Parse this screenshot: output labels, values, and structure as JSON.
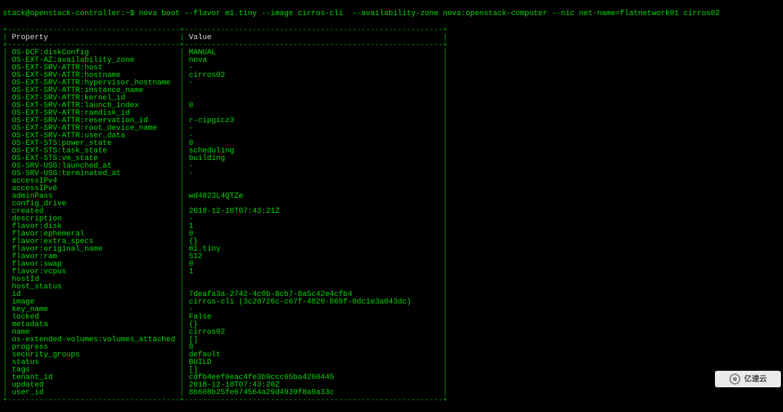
{
  "prompt": "stack@openstack-controller:~$ nova boot --flavor m1.tiny --image cirros-cli  --availability-zone nova:openstack-computer --nic net-name=flatnetwork01 cirros02",
  "header": {
    "col1": "Property",
    "col2": "Value"
  },
  "col1_width": 38,
  "col2_width": 57,
  "rows": [
    {
      "p": "OS-DCF:diskConfig",
      "v": "MANUAL"
    },
    {
      "p": "OS-EXT-AZ:availability_zone",
      "v": "nova"
    },
    {
      "p": "OS-EXT-SRV-ATTR:host",
      "v": "-"
    },
    {
      "p": "OS-EXT-SRV-ATTR:hostname",
      "v": "cirros02"
    },
    {
      "p": "OS-EXT-SRV-ATTR:hypervisor_hostname",
      "v": "-"
    },
    {
      "p": "OS-EXT-SRV-ATTR:instance_name",
      "v": ""
    },
    {
      "p": "OS-EXT-SRV-ATTR:kernel_id",
      "v": ""
    },
    {
      "p": "OS-EXT-SRV-ATTR:launch_index",
      "v": "0"
    },
    {
      "p": "OS-EXT-SRV-ATTR:ramdisk_id",
      "v": ""
    },
    {
      "p": "OS-EXT-SRV-ATTR:reservation_id",
      "v": "r-cipgicz3"
    },
    {
      "p": "OS-EXT-SRV-ATTR:root_device_name",
      "v": "-"
    },
    {
      "p": "OS-EXT-SRV-ATTR:user_data",
      "v": "-"
    },
    {
      "p": "OS-EXT-STS:power_state",
      "v": "0"
    },
    {
      "p": "OS-EXT-STS:task_state",
      "v": "scheduling"
    },
    {
      "p": "OS-EXT-STS:vm_state",
      "v": "building"
    },
    {
      "p": "OS-SRV-USG:launched_at",
      "v": "-"
    },
    {
      "p": "OS-SRV-USG:terminated_at",
      "v": "-"
    },
    {
      "p": "accessIPv4",
      "v": ""
    },
    {
      "p": "accessIPv6",
      "v": ""
    },
    {
      "p": "adminPass",
      "v": "wd4823L4QTZe"
    },
    {
      "p": "config_drive",
      "v": ""
    },
    {
      "p": "created",
      "v": "2018-12-18T07:43:21Z"
    },
    {
      "p": "description",
      "v": "-"
    },
    {
      "p": "flavor:disk",
      "v": "1"
    },
    {
      "p": "flavor:ephemeral",
      "v": "0"
    },
    {
      "p": "flavor:extra_specs",
      "v": "{}"
    },
    {
      "p": "flavor:original_name",
      "v": "m1.tiny"
    },
    {
      "p": "flavor:ram",
      "v": "512"
    },
    {
      "p": "flavor:swap",
      "v": "0"
    },
    {
      "p": "flavor:vcpus",
      "v": "1"
    },
    {
      "p": "hostId",
      "v": ""
    },
    {
      "p": "host_status",
      "v": ""
    },
    {
      "p": "id",
      "v": "7deafa3a-2742-4c0b-8cb7-8a5c42e4cfb4"
    },
    {
      "p": "image",
      "v": "cirros-cli (3c2d726c-c67f-4820-869f-0dc1e3a043dc)"
    },
    {
      "p": "key_name",
      "v": "-"
    },
    {
      "p": "locked",
      "v": "False"
    },
    {
      "p": "metadata",
      "v": "{}"
    },
    {
      "p": "name",
      "v": "cirros02"
    },
    {
      "p": "os-extended-volumes:volumes_attached",
      "v": "[]"
    },
    {
      "p": "progress",
      "v": "0"
    },
    {
      "p": "security_groups",
      "v": "default"
    },
    {
      "p": "status",
      "v": "BUILD"
    },
    {
      "p": "tags",
      "v": "[]"
    },
    {
      "p": "tenant_id",
      "v": "cdfb4eef0eac4fe3b9ccc65ba4260445"
    },
    {
      "p": "updated",
      "v": "2018-12-18T07:43:20Z"
    },
    {
      "p": "user_id",
      "v": "8b608b25fe674564a29d4939f8a9a33c"
    }
  ],
  "watermark": "亿速云"
}
